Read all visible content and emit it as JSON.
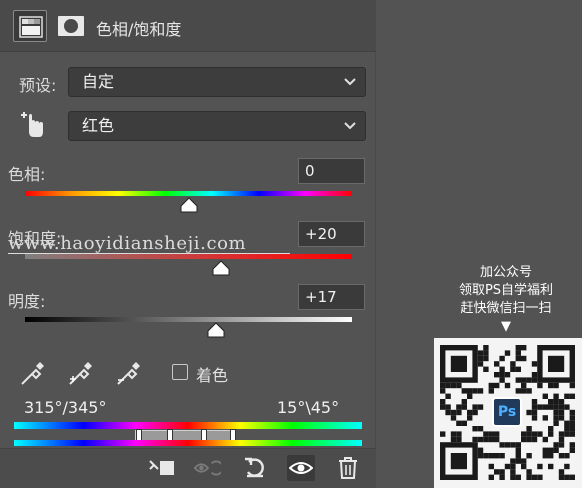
{
  "panel": {
    "title": "色相/饱和度",
    "preset_label": "预设:",
    "preset_value": "自定",
    "channel_value": "红色"
  },
  "hue": {
    "label": "色相:",
    "value": "0",
    "level": 0.5
  },
  "saturation": {
    "label": "饱和度:",
    "value": "+20",
    "level": 0.6
  },
  "lightness": {
    "label": "明度:",
    "value": "+17",
    "level": 0.585
  },
  "watermark": "www.haoyidiansheji.com",
  "colorize": {
    "label": "着色",
    "checked": false
  },
  "range": {
    "left": "315°/345°",
    "right": "15°\\45°"
  },
  "promo": {
    "line1": "加公众号",
    "line2": "领取PS自学福利",
    "line3": "赶快微信扫一扫",
    "arrow": "▼",
    "logo_text": "Ps"
  },
  "icons": {
    "header": [
      "levels-adjustment-icon",
      "layer-mask-icon"
    ],
    "tools": [
      "eyedropper-icon",
      "eyedropper-add-icon",
      "eyedropper-subtract-icon"
    ],
    "bottom": [
      "clip-to-layer-icon",
      "view-previous-state-icon",
      "reset-icon",
      "visibility-eye-icon",
      "trash-icon"
    ],
    "channel": "targeted-adjustment-hand-icon"
  }
}
